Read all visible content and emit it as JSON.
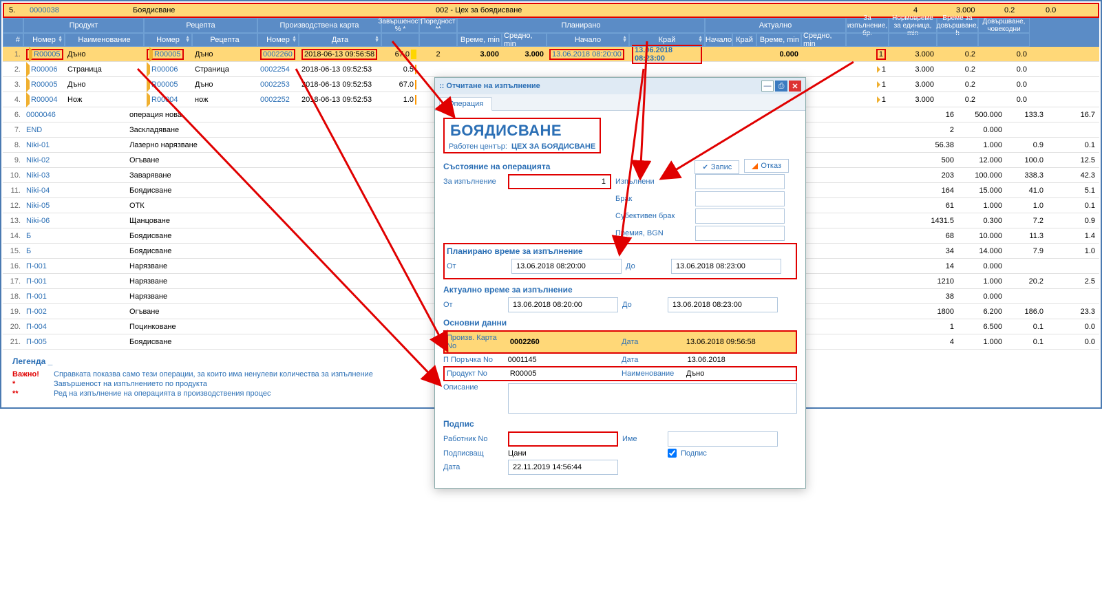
{
  "topRow": {
    "idx": "5.",
    "code": "0000038",
    "op": "Боядисване",
    "center": "002 - Цех за боядисване",
    "qty": "4",
    "norm": "3.000",
    "fin": "0.2",
    "mh": "0.0"
  },
  "hdr": {
    "product": "Продукт",
    "recipe": "Рецепта",
    "card": "Производствена карта",
    "completion": "Завършеност, % *",
    "order": "Поредност **",
    "planned": "Планирано",
    "actual": "Актуално",
    "forExec": "За изпълнение, бр.",
    "normTime": "Нормовреме за единица, min",
    "finishTime": "Време за довършване, h",
    "manDays": "Довършване, човекодни",
    "idx": "#",
    "num": "Номер",
    "name": "Наименование",
    "rnum": "Номер",
    "rname": "Рецепта",
    "knum": "Номер",
    "kdate": "Дата",
    "time": "Време, min",
    "avg": "Средно, min",
    "start": "Начало",
    "end": "Край",
    "astart": "Начало",
    "aend": "Край"
  },
  "rows": [
    {
      "idx": "1.",
      "num": "R00005",
      "name": "Дъно",
      "rnum": "R00005",
      "rname": "Дъно",
      "knum": "0002260",
      "kdate": "2018-06-13 09:56:58",
      "comp": "67.0",
      "ord": "2",
      "time": "3.000",
      "avg": "3.000",
      "start": "13.06.2018 08:20:00",
      "end": "13.06.2018 08:23:00",
      "atime": "0.000",
      "qty": "1",
      "norm": "3.000",
      "fin": "0.2",
      "mh": "0.0",
      "sel": true,
      "hlr": true
    },
    {
      "idx": "2.",
      "num": "R00006",
      "name": "Страница",
      "rnum": "R00006",
      "rname": "Страница",
      "knum": "0002254",
      "kdate": "2018-06-13 09:52:53",
      "comp": "0.5",
      "ord": "",
      "time": "",
      "avg": "",
      "start": "",
      "end": "",
      "atime": "",
      "qty": "1",
      "norm": "3.000",
      "fin": "0.2",
      "mh": "0.0"
    },
    {
      "idx": "3.",
      "num": "R00005",
      "name": "Дъно",
      "rnum": "R00005",
      "rname": "Дъно",
      "knum": "0002253",
      "kdate": "2018-06-13 09:52:53",
      "comp": "67.0",
      "ord": "",
      "time": "",
      "avg": "",
      "start": "",
      "end": "",
      "atime": "",
      "qty": "1",
      "norm": "3.000",
      "fin": "0.2",
      "mh": "0.0"
    },
    {
      "idx": "4.",
      "num": "R00004",
      "name": "Нож",
      "rnum": "R00004",
      "rname": "нож",
      "knum": "0002252",
      "kdate": "2018-06-13 09:52:53",
      "comp": "1.0",
      "ord": "",
      "time": "",
      "avg": "",
      "start": "",
      "end": "",
      "atime": "",
      "qty": "1",
      "norm": "3.000",
      "fin": "0.2",
      "mh": "0.0"
    }
  ],
  "ops": [
    {
      "n": "6.",
      "code": "0000046",
      "desc": "операция нова",
      "q": "16",
      "norm": "500.000",
      "fin": "133.3",
      "mh": "16.7"
    },
    {
      "n": "7.",
      "code": "END",
      "desc": "Заскладяване",
      "q": "2",
      "norm": "0.000",
      "fin": "",
      "mh": ""
    },
    {
      "n": "8.",
      "code": "Niki-01",
      "desc": "Лазерно нарязване",
      "q": "56.38",
      "norm": "1.000",
      "fin": "0.9",
      "mh": "0.1"
    },
    {
      "n": "9.",
      "code": "Niki-02",
      "desc": "Огъване",
      "q": "500",
      "norm": "12.000",
      "fin": "100.0",
      "mh": "12.5"
    },
    {
      "n": "10.",
      "code": "Niki-03",
      "desc": "Заваряване",
      "q": "203",
      "norm": "100.000",
      "fin": "338.3",
      "mh": "42.3"
    },
    {
      "n": "11.",
      "code": "Niki-04",
      "desc": "Боядисване",
      "q": "164",
      "norm": "15.000",
      "fin": "41.0",
      "mh": "5.1"
    },
    {
      "n": "12.",
      "code": "Niki-05",
      "desc": "ОТК",
      "q": "61",
      "norm": "1.000",
      "fin": "1.0",
      "mh": "0.1"
    },
    {
      "n": "13.",
      "code": "Niki-06",
      "desc": "Щанцоване",
      "q": "1431.5",
      "norm": "0.300",
      "fin": "7.2",
      "mh": "0.9"
    },
    {
      "n": "14.",
      "code": "Б",
      "desc": "Боядисване",
      "q": "68",
      "norm": "10.000",
      "fin": "11.3",
      "mh": "1.4"
    },
    {
      "n": "15.",
      "code": "Б",
      "desc": "Боядисване",
      "q": "34",
      "norm": "14.000",
      "fin": "7.9",
      "mh": "1.0"
    },
    {
      "n": "16.",
      "code": "П-001",
      "desc": "Нарязване",
      "q": "14",
      "norm": "0.000",
      "fin": "",
      "mh": ""
    },
    {
      "n": "17.",
      "code": "П-001",
      "desc": "Нарязване",
      "q": "1210",
      "norm": "1.000",
      "fin": "20.2",
      "mh": "2.5"
    },
    {
      "n": "18.",
      "code": "П-001",
      "desc": "Нарязване",
      "q": "38",
      "norm": "0.000",
      "fin": "",
      "mh": ""
    },
    {
      "n": "19.",
      "code": "П-002",
      "desc": "Огъване",
      "q": "1800",
      "norm": "6.200",
      "fin": "186.0",
      "mh": "23.3"
    },
    {
      "n": "20.",
      "code": "П-004",
      "desc": "Поцинковане",
      "q": "1",
      "norm": "6.500",
      "fin": "0.1",
      "mh": "0.0"
    },
    {
      "n": "21.",
      "code": "П-005",
      "desc": "Боядисване",
      "q": "4",
      "norm": "1.000",
      "fin": "0.1",
      "mh": "0.0"
    }
  ],
  "legend": {
    "title": "Легенда _",
    "r1k": "Важно!",
    "r1t": "Справката показва само тези операции, за които има ненулеви количества за изпълнение",
    "r2k": "*",
    "r2t": "Завършеност на изпълнението по продукта",
    "r3k": "**",
    "r3t": "Ред на изпълнение на операцията в производствения процес"
  },
  "dlg": {
    "title": ":: Отчитане на изпълнение",
    "tab": "Операция",
    "op": "БОЯДИСВАНЕ",
    "wcLbl": "Работен център:",
    "wc": "ЦЕХ ЗА БОЯДИСВАНЕ",
    "sState": "Състояние на операцията",
    "save": "Запис",
    "cancel": "Отказ",
    "forExec": "За изпълнение",
    "forExecVal": "1",
    "done": "Изпълнени",
    "scrap": "Брак",
    "subj": "Субективен брак",
    "bonus": "Премия, BGN",
    "sPlan": "Планирано време за изпълнение",
    "from": "От",
    "to": "До",
    "planFrom": "13.06.2018 08:20:00",
    "planTo": "13.06.2018 08:23:00",
    "sAct": "Актуално време за изпълнение",
    "actFrom": "13.06.2018 08:20:00",
    "actTo": "13.06.2018 08:23:00",
    "sMain": "Основни данни",
    "cardNo": "Произв. Карта No",
    "cardNoVal": "0002260",
    "date": "Дата",
    "dateVal": "13.06.2018 09:56:58",
    "orderNo": "П Поръчка No",
    "orderNoVal": "0001145",
    "orderDate": "13.06.2018",
    "prodNo": "Продукт No",
    "prodNoVal": "R00005",
    "prodName": "Наименование",
    "prodNameVal": "Дъно",
    "desc": "Описание",
    "sSign": "Подпис",
    "worker": "Работник No",
    "wname": "Име",
    "signer": "Подписващ",
    "signerVal": "Цани",
    "sign": "Подпис",
    "sdate": "Дата",
    "sdateVal": "22.11.2019 14:56:44"
  }
}
